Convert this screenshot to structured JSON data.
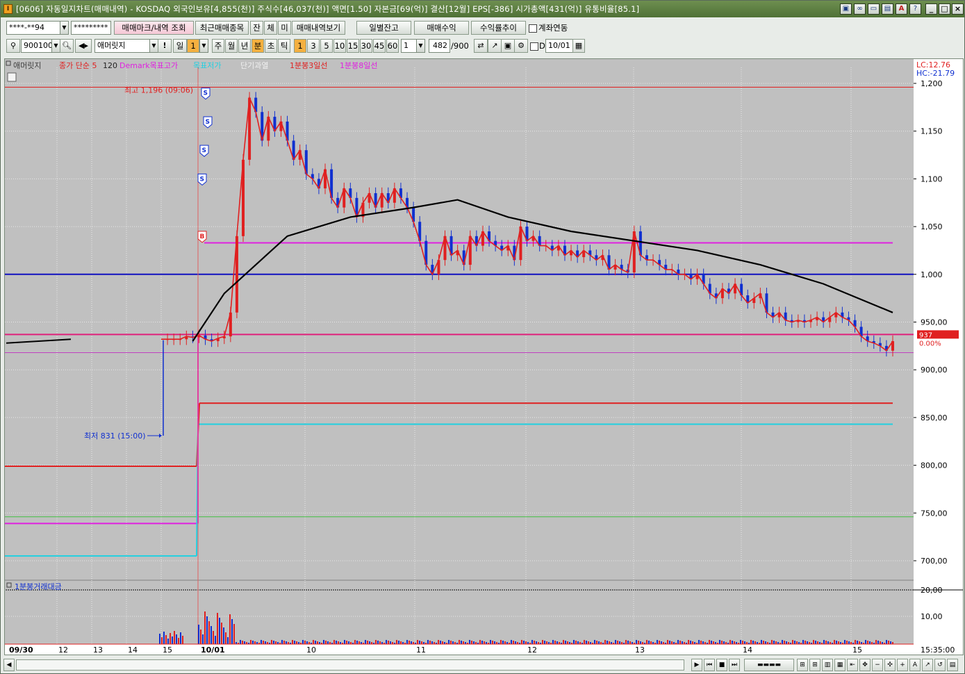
{
  "window": {
    "title": "[0606] 자동일지차트(매매내역) - KOSDAQ 외국인보유[4,855(천)] 주식수[46,037(천)] 액면[1.50] 자본금[69(억)] 결산[12월] EPS[-386] 시가총액[431(억)] 유통비율[85.1]",
    "app_icon": "I",
    "tool_icons": [
      "window-tile-icon",
      "link-icon",
      "monitor-icon",
      "screen-icon",
      "font-a-icon",
      "help-icon"
    ],
    "minimize": "_",
    "maximize": "□",
    "close": "×"
  },
  "toolbar1": {
    "account": "****-**94",
    "password": "*********",
    "btn_trade_mark": "매매마크/내역 조회",
    "btn_recent_items": "최근매매종목",
    "btn_jan": "잔",
    "btn_che": "체",
    "btn_mi": "미",
    "btn_trade_view": "매매내역보기",
    "btn_daily_balance": "일별잔고",
    "btn_trade_profit": "매매수익",
    "btn_return_trend": "수익률추이",
    "link_account": "계좌연동"
  },
  "toolbar2": {
    "stock_code": "900100",
    "stock_name": "애머릿지",
    "period_day": "일",
    "period_day_value": "1",
    "periods": [
      "주",
      "월",
      "년",
      "분",
      "초",
      "틱"
    ],
    "active_period": "분",
    "minute_intervals": [
      "1",
      "3",
      "5",
      "10",
      "15",
      "30",
      "45",
      "60"
    ],
    "active_interval": "1",
    "multiplier": "1",
    "count": "482",
    "count_max": "/900",
    "d_label": "D",
    "date": "10/01"
  },
  "chart": {
    "legend": [
      {
        "text": "애머릿지",
        "color": "#404040"
      },
      {
        "text": "종가 단순 5",
        "color": "#e02020"
      },
      {
        "text": "120",
        "color": "#202020"
      },
      {
        "text": "Demark목표고가",
        "color": "#e020e0"
      },
      {
        "text": "목표저가",
        "color": "#20d0e0"
      },
      {
        "text": "단기과열",
        "color": "#f0f0f0"
      },
      {
        "text": "1분봉3일선",
        "color": "#e02020"
      },
      {
        "text": "1분봉8일선",
        "color": "#e020e0"
      }
    ],
    "lc": "LC:12.76",
    "hc": "HC:-21.79",
    "high_annotation": "최고 1,196 (09:06)",
    "low_annotation": "최저 831 (15:00)",
    "current_price": "937",
    "current_change": "0.00%",
    "volume_title": "1분봉거래대금",
    "time_label": "15:35:00",
    "trade_marks": [
      "S",
      "S",
      "S",
      "S",
      "B"
    ]
  },
  "chart_data": {
    "type": "candlestick",
    "y_axis": {
      "ticks": [
        "1,200",
        "1,150",
        "1,100",
        "1,050",
        "1,000",
        "950,00",
        "900,00",
        "850,00",
        "800,00",
        "750,00",
        "700,00"
      ],
      "ylim": [
        685,
        1200
      ]
    },
    "volume_axis": {
      "ticks": [
        "20,00",
        "10,00"
      ]
    },
    "x_ticks": [
      "09/30",
      "12",
      "13",
      "14",
      "15",
      "10/01",
      "10",
      "11",
      "12",
      "13",
      "14",
      "15"
    ],
    "price_path": [
      [
        0,
        932
      ],
      [
        1,
        932
      ],
      [
        2,
        932
      ],
      [
        3,
        932
      ],
      [
        4,
        935
      ],
      [
        5,
        934
      ],
      [
        6,
        936
      ],
      [
        7,
        932
      ],
      [
        8,
        930
      ],
      [
        9,
        933
      ],
      [
        10,
        935
      ],
      [
        11,
        960
      ],
      [
        12,
        1040
      ],
      [
        13,
        1120
      ],
      [
        14,
        1185
      ],
      [
        15,
        1170
      ],
      [
        16,
        1140
      ],
      [
        17,
        1165
      ],
      [
        18,
        1150
      ],
      [
        19,
        1160
      ],
      [
        20,
        1140
      ],
      [
        21,
        1120
      ],
      [
        22,
        1130
      ],
      [
        23,
        1105
      ],
      [
        24,
        1100
      ],
      [
        25,
        1090
      ],
      [
        26,
        1110
      ],
      [
        27,
        1080
      ],
      [
        28,
        1070
      ],
      [
        29,
        1090
      ],
      [
        30,
        1080
      ],
      [
        31,
        1060
      ],
      [
        32,
        1075
      ],
      [
        33,
        1085
      ],
      [
        34,
        1070
      ],
      [
        35,
        1085
      ],
      [
        36,
        1075
      ],
      [
        37,
        1090
      ],
      [
        38,
        1080
      ],
      [
        39,
        1070
      ],
      [
        40,
        1055
      ],
      [
        41,
        1035
      ],
      [
        42,
        1010
      ],
      [
        43,
        1000
      ],
      [
        44,
        1015
      ],
      [
        45,
        1040
      ],
      [
        46,
        1020
      ],
      [
        47,
        1025
      ],
      [
        48,
        1010
      ],
      [
        49,
        1040
      ],
      [
        50,
        1030
      ],
      [
        51,
        1045
      ],
      [
        52,
        1035
      ],
      [
        53,
        1030
      ],
      [
        54,
        1025
      ],
      [
        55,
        1030
      ],
      [
        56,
        1015
      ],
      [
        57,
        1050
      ],
      [
        58,
        1035
      ],
      [
        59,
        1040
      ],
      [
        60,
        1030
      ],
      [
        61,
        1030
      ],
      [
        62,
        1025
      ],
      [
        63,
        1030
      ],
      [
        64,
        1020
      ],
      [
        65,
        1025
      ],
      [
        66,
        1018
      ],
      [
        67,
        1025
      ],
      [
        68,
        1020
      ],
      [
        69,
        1015
      ],
      [
        70,
        1020
      ],
      [
        71,
        1005
      ],
      [
        72,
        1010
      ],
      [
        73,
        1005
      ],
      [
        74,
        1002
      ],
      [
        75,
        1045
      ],
      [
        76,
        1020
      ],
      [
        77,
        1015
      ],
      [
        78,
        1015
      ],
      [
        79,
        1010
      ],
      [
        80,
        1005
      ],
      [
        81,
        1005
      ],
      [
        82,
        1000
      ],
      [
        83,
        1000
      ],
      [
        84,
        995
      ],
      [
        85,
        1000
      ],
      [
        86,
        990
      ],
      [
        87,
        980
      ],
      [
        88,
        975
      ],
      [
        89,
        985
      ],
      [
        90,
        980
      ],
      [
        91,
        990
      ],
      [
        92,
        978
      ],
      [
        93,
        970
      ],
      [
        94,
        975
      ],
      [
        95,
        980
      ],
      [
        96,
        960
      ],
      [
        97,
        955
      ],
      [
        98,
        960
      ],
      [
        99,
        952
      ],
      [
        100,
        950
      ],
      [
        101,
        952
      ],
      [
        102,
        950
      ],
      [
        103,
        952
      ],
      [
        104,
        955
      ],
      [
        105,
        950
      ],
      [
        106,
        955
      ],
      [
        107,
        960
      ],
      [
        108,
        955
      ],
      [
        109,
        952
      ],
      [
        110,
        945
      ],
      [
        111,
        935
      ],
      [
        112,
        930
      ],
      [
        113,
        928
      ],
      [
        114,
        925
      ],
      [
        115,
        920
      ],
      [
        116,
        930
      ]
    ],
    "ma120": [
      [
        5,
        930
      ],
      [
        10,
        980
      ],
      [
        20,
        1040
      ],
      [
        30,
        1060
      ],
      [
        40,
        1070
      ],
      [
        47,
        1078
      ],
      [
        55,
        1060
      ],
      [
        65,
        1045
      ],
      [
        75,
        1035
      ],
      [
        85,
        1025
      ],
      [
        95,
        1010
      ],
      [
        105,
        990
      ],
      [
        116,
        960
      ]
    ],
    "pre_line": [
      [
        0,
        928
      ],
      [
        4,
        932
      ]
    ],
    "hlines": {
      "top_red": 1196,
      "blue": 1000,
      "pink": 937,
      "purple_low": 918,
      "magenta": 1033,
      "red_right": 865,
      "cyan_right": 843,
      "red_left": 799,
      "magenta_left": 739,
      "cyan_left": 705,
      "green": 746
    }
  }
}
